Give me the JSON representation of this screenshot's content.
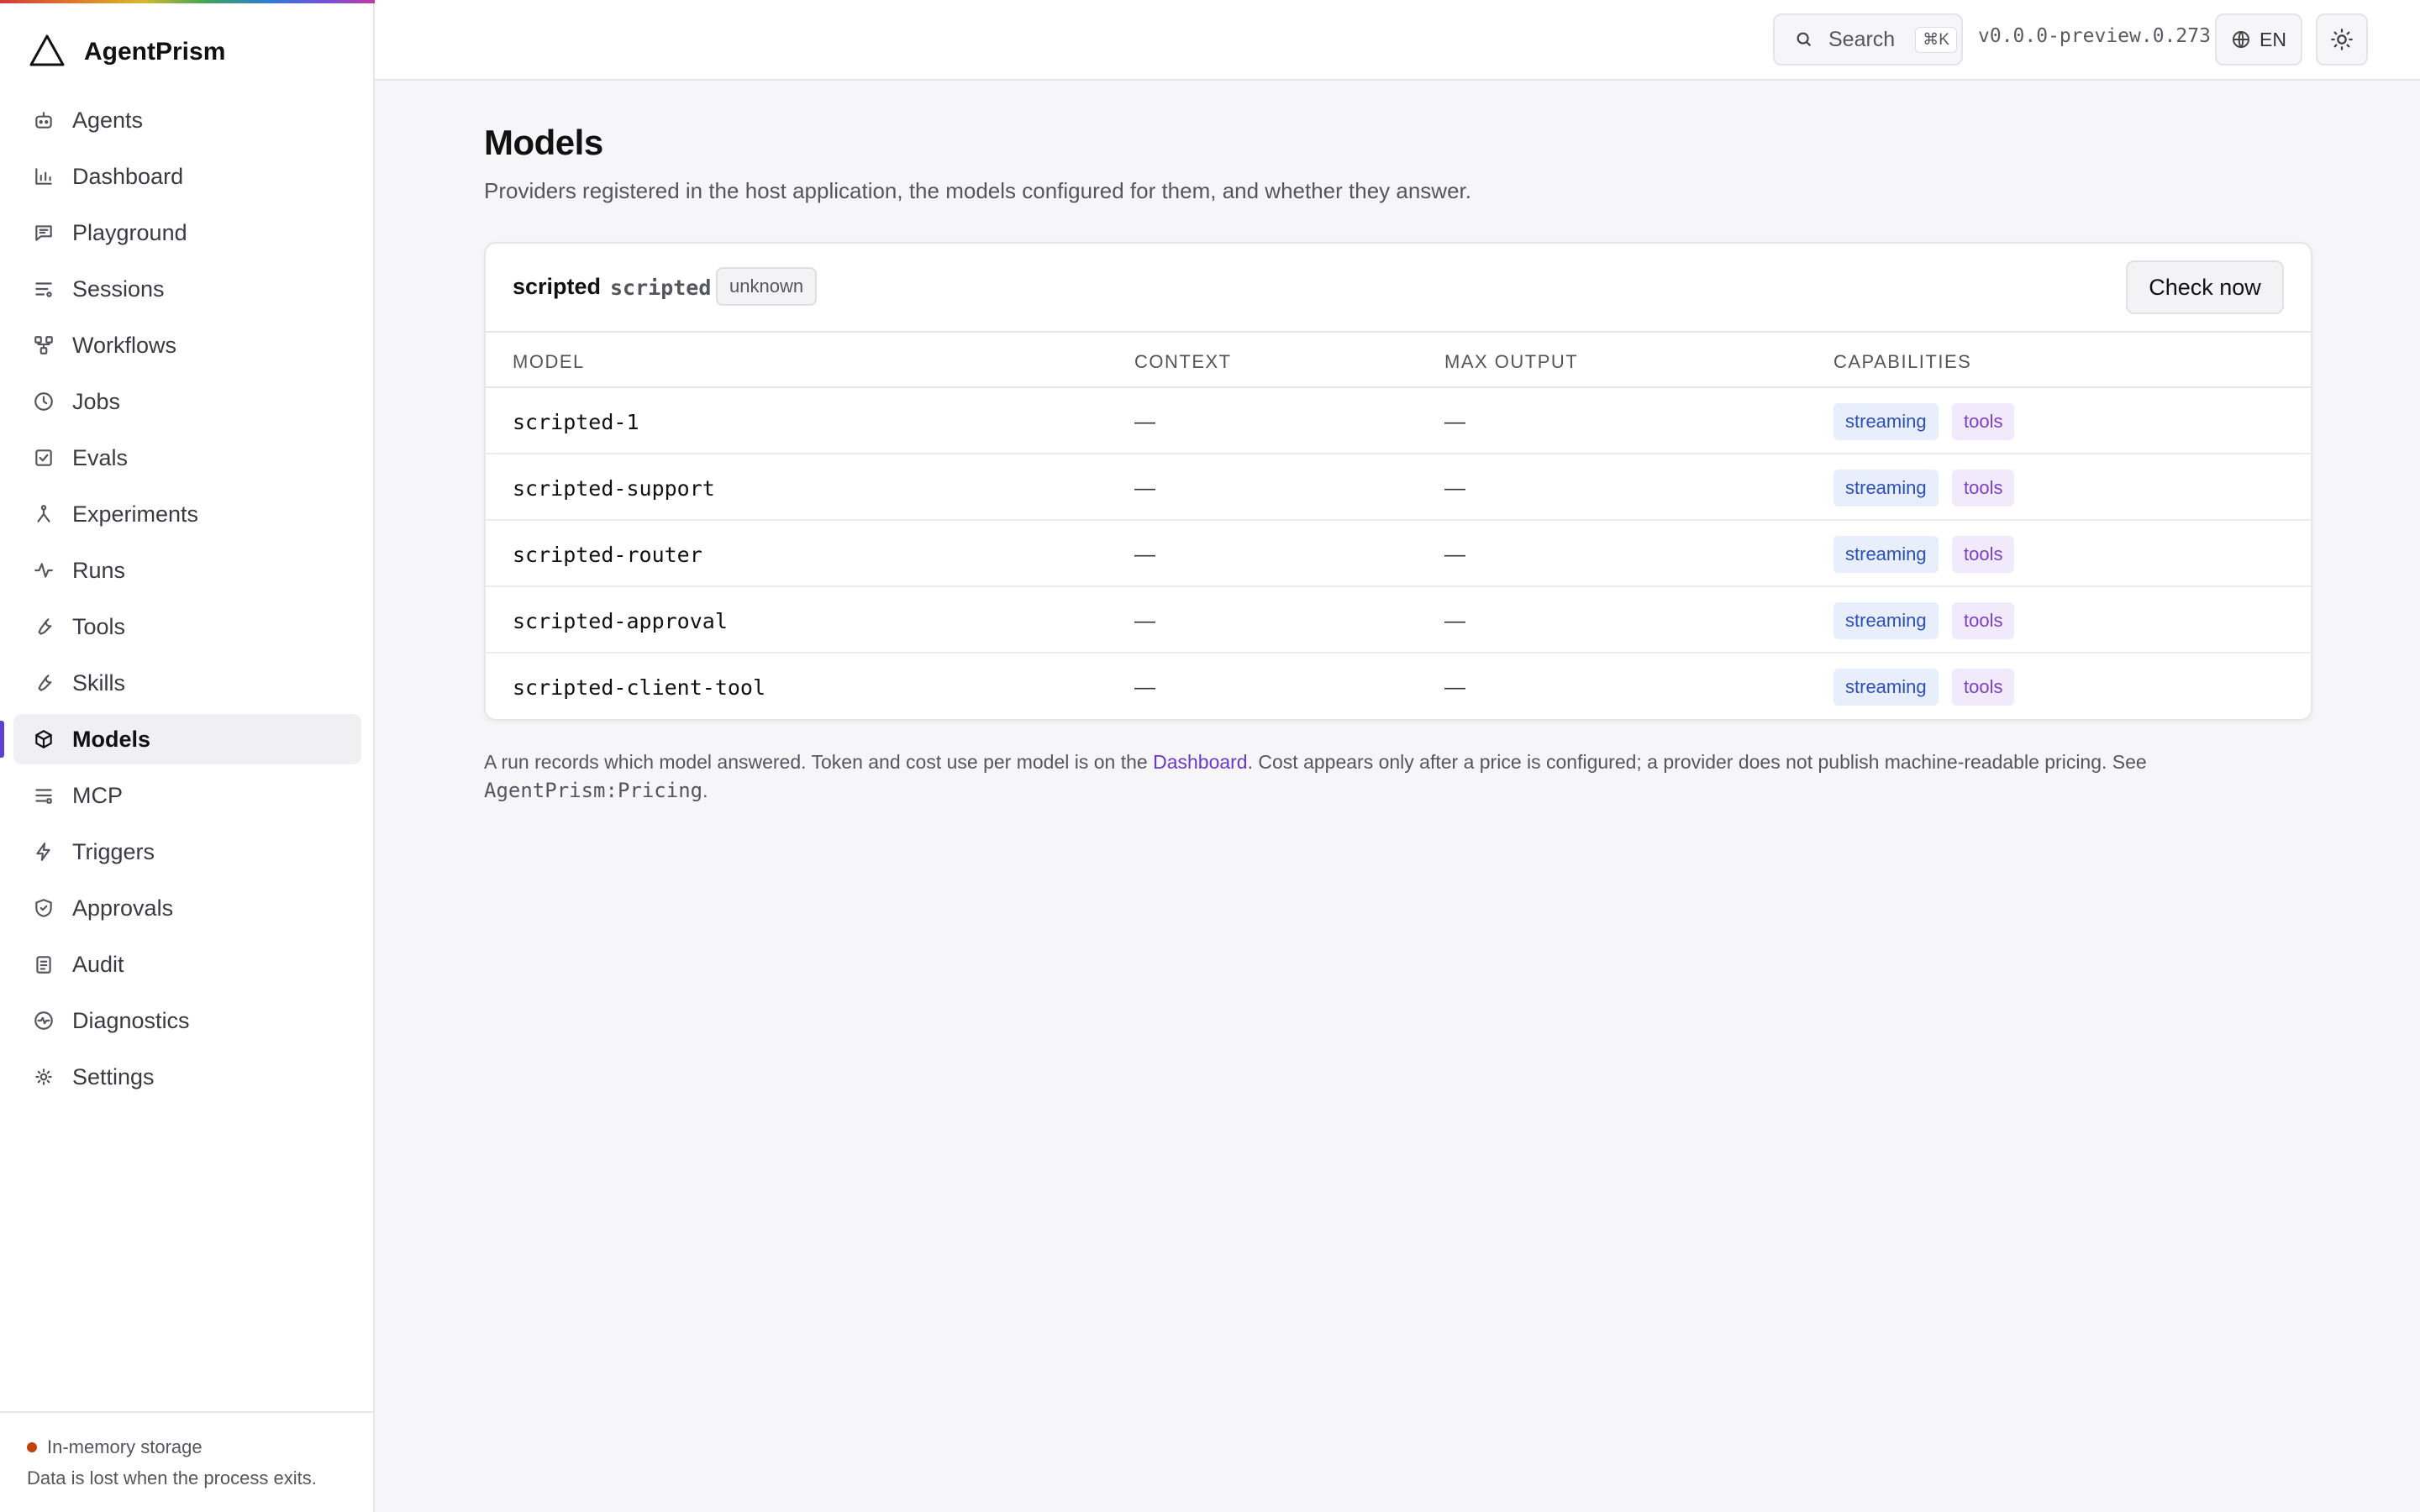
{
  "app": {
    "name": "AgentPrism",
    "accent_color": "#5b3fd6"
  },
  "sidebar": {
    "items": [
      {
        "label": "Agents",
        "icon": "bot-icon"
      },
      {
        "label": "Dashboard",
        "icon": "bar-chart-icon"
      },
      {
        "label": "Playground",
        "icon": "message-square-icon"
      },
      {
        "label": "Sessions",
        "icon": "list-filter-icon"
      },
      {
        "label": "Workflows",
        "icon": "workflow-icon"
      },
      {
        "label": "Jobs",
        "icon": "clock-icon"
      },
      {
        "label": "Evals",
        "icon": "check-square-icon"
      },
      {
        "label": "Experiments",
        "icon": "flask-icon"
      },
      {
        "label": "Runs",
        "icon": "activity-icon"
      },
      {
        "label": "Tools",
        "icon": "wrench-icon"
      },
      {
        "label": "Skills",
        "icon": "wrench-icon"
      },
      {
        "label": "Models",
        "icon": "box-icon",
        "active": true
      },
      {
        "label": "MCP",
        "icon": "server-list-icon"
      },
      {
        "label": "Triggers",
        "icon": "zap-icon"
      },
      {
        "label": "Approvals",
        "icon": "shield-check-icon"
      },
      {
        "label": "Audit",
        "icon": "clipboard-icon"
      },
      {
        "label": "Diagnostics",
        "icon": "heart-pulse-icon"
      },
      {
        "label": "Settings",
        "icon": "sun-gear-icon"
      }
    ],
    "storage": {
      "title": "In-memory storage",
      "subtitle": "Data is lost when the process exits.",
      "status_color": "#c2410c"
    }
  },
  "topbar": {
    "search_label": "Search",
    "search_shortcut": "⌘K",
    "version": "v0.0.0-preview.0.273",
    "language": "EN"
  },
  "main": {
    "title": "Models",
    "description": "Providers registered in the host application, the models configured for them, and whether they answer.",
    "provider": {
      "name": "scripted",
      "id": "scripted",
      "status": "unknown",
      "check_label": "Check now"
    },
    "table": {
      "headers": [
        "MODEL",
        "CONTEXT",
        "MAX OUTPUT",
        "CAPABILITIES"
      ],
      "rows": [
        {
          "model": "scripted-1",
          "context": "—",
          "max_output": "—",
          "caps": [
            "streaming",
            "tools"
          ]
        },
        {
          "model": "scripted-support",
          "context": "—",
          "max_output": "—",
          "caps": [
            "streaming",
            "tools"
          ]
        },
        {
          "model": "scripted-router",
          "context": "—",
          "max_output": "—",
          "caps": [
            "streaming",
            "tools"
          ]
        },
        {
          "model": "scripted-approval",
          "context": "—",
          "max_output": "—",
          "caps": [
            "streaming",
            "tools"
          ]
        },
        {
          "model": "scripted-client-tool",
          "context": "—",
          "max_output": "—",
          "caps": [
            "streaming",
            "tools"
          ]
        }
      ]
    },
    "footnote": {
      "part1": "A run records which model answered. Token and cost use per model is on the ",
      "link": "Dashboard",
      "part2": ". Cost appears only after a price is configured; a provider does not publish machine-readable pricing. See ",
      "code": "AgentPrism:Pricing",
      "part3": "."
    }
  }
}
